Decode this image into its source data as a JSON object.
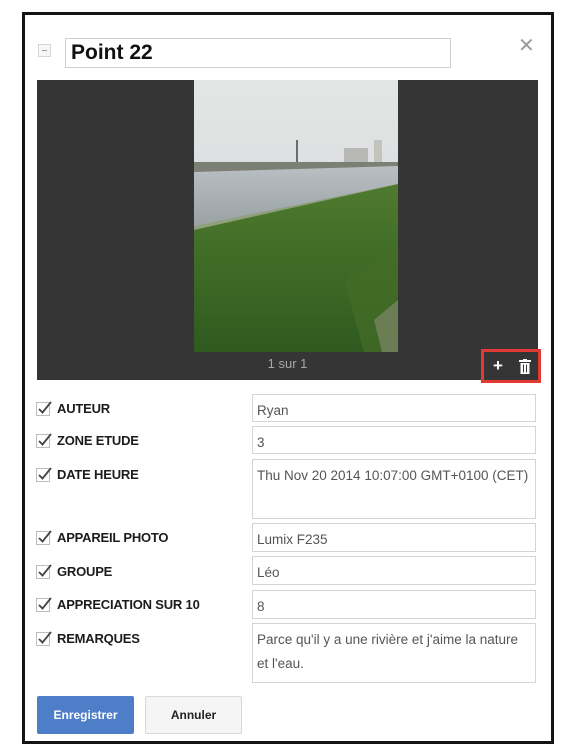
{
  "dialog": {
    "title": "Point 22",
    "close_glyph": "✕",
    "collapse_icon": "collapse-icon"
  },
  "viewer": {
    "counter_text": "1 sur 1",
    "add_glyph": "+",
    "background": "#353535",
    "highlight_color": "#e23a33"
  },
  "fields": [
    {
      "label": "AUTEUR",
      "value": "Ryan",
      "checked": true
    },
    {
      "label": "ZONE ETUDE",
      "value": "3",
      "checked": true
    },
    {
      "label": "DATE HEURE",
      "value": "Thu Nov 20 2014 10:07:00 GMT+0100 (CET)",
      "checked": true
    },
    {
      "label": "APPAREIL PHOTO",
      "value": "Lumix F235",
      "checked": true
    },
    {
      "label": "GROUPE",
      "value": "Léo",
      "checked": true
    },
    {
      "label": "APPRECIATION SUR 10",
      "value": "8",
      "checked": true
    },
    {
      "label": "REMARQUES",
      "value": "Parce qu'il y a une rivière et j'aime la nature et l'eau.",
      "checked": true
    }
  ],
  "buttons": {
    "save_label": "Enregistrer",
    "cancel_label": "Annuler",
    "accent": "#4d7ec7"
  }
}
